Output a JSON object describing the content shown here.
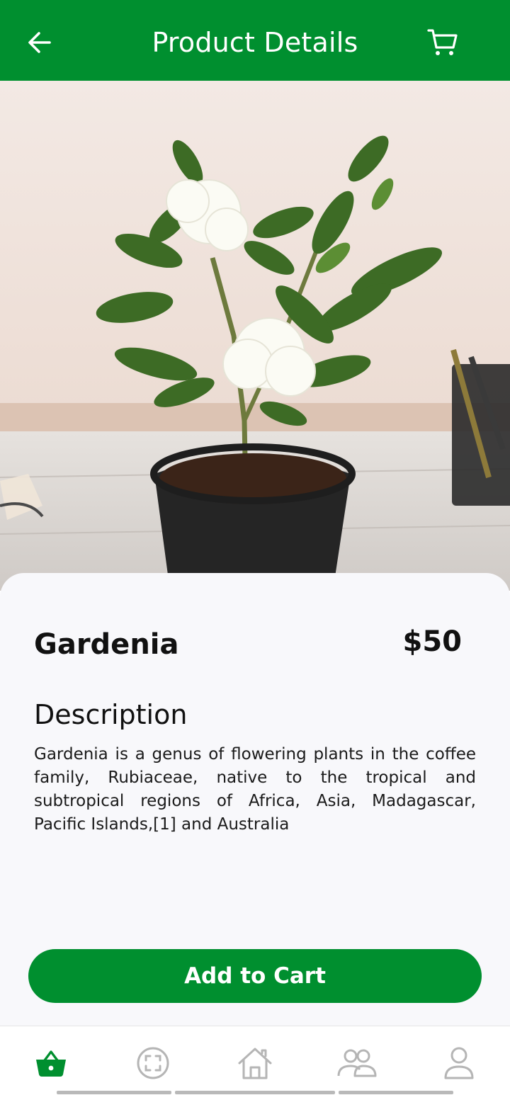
{
  "header": {
    "title": "Product Details",
    "back_icon": "arrow-left-icon",
    "cart_icon": "cart-icon"
  },
  "product": {
    "name": "Gardenia",
    "price": "$50",
    "description_heading": "Description",
    "description": "Gardenia is a genus of flowering plants in the coffee family, Rubiaceae, native to the tropical and subtropical regions of Africa, Asia, Madagascar, Pacific Islands,[1] and Australia"
  },
  "actions": {
    "add_to_cart": "Add to Cart"
  },
  "bottom_nav": [
    {
      "icon": "basket-icon",
      "active": true
    },
    {
      "icon": "scan-icon",
      "active": false
    },
    {
      "icon": "home-icon",
      "active": false
    },
    {
      "icon": "community-icon",
      "active": false
    },
    {
      "icon": "profile-icon",
      "active": false
    }
  ],
  "colors": {
    "primary": "#008f2f",
    "sheet_bg": "#f8f8fb",
    "icon_inactive": "#b5b5b5"
  }
}
